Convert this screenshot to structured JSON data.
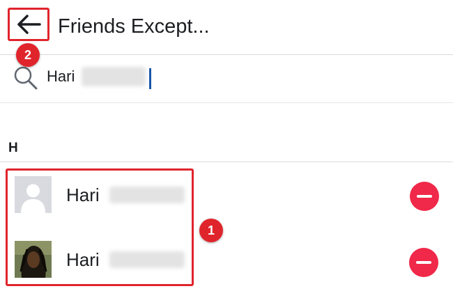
{
  "header": {
    "title": "Friends Except...",
    "back_icon": "arrow-left-icon"
  },
  "search": {
    "value": "Hari",
    "icon": "search-icon"
  },
  "section": {
    "letter": "H"
  },
  "friends": [
    {
      "name": "Hari",
      "avatar": "default-avatar",
      "action_icon": "minus-circle-icon"
    },
    {
      "name": "Hari",
      "avatar": "photo-avatar",
      "action_icon": "minus-circle-icon"
    }
  ],
  "annotations": {
    "callout_1": "1",
    "callout_2": "2",
    "highlight_color": "#e0242c"
  },
  "colors": {
    "remove_button": "#f02849",
    "caret": "#1a56a8"
  }
}
